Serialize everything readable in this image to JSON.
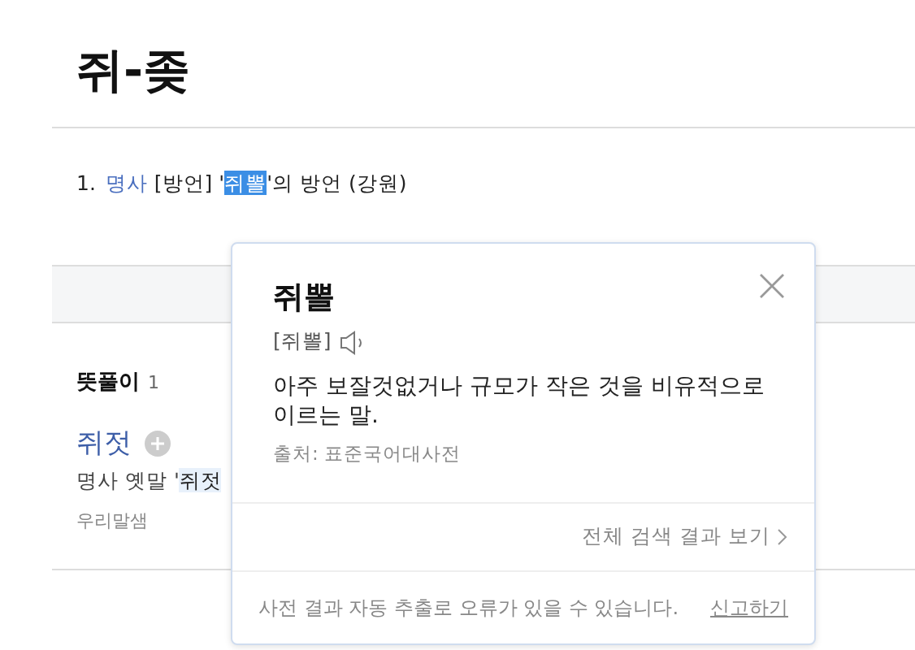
{
  "title": "쥐-좆",
  "sense": {
    "number": "1.",
    "pos": "명사",
    "before": "[방언] '",
    "highlight": "쥐뽈",
    "after": "'의 방언 (강원)"
  },
  "section": {
    "heading": "뜻풀이",
    "count": "1"
  },
  "entry": {
    "word": "쥐젓",
    "pos_text": "명사 옛말 '",
    "highlight": "쥐젓",
    "source": "우리말샘"
  },
  "popup": {
    "word": "쥐뽈",
    "pronunciation": "[쥐뽈]",
    "definition": "아주 보잘것없거나 규모가 작은 것을 비유적으로 이르는 말.",
    "source": "출처: 표준국어대사전",
    "more_link": "전체 검색 결과 보기",
    "notice": "사전 결과 자동 추출로 오류가 있을 수 있습니다.",
    "report_link": "신고하기"
  }
}
